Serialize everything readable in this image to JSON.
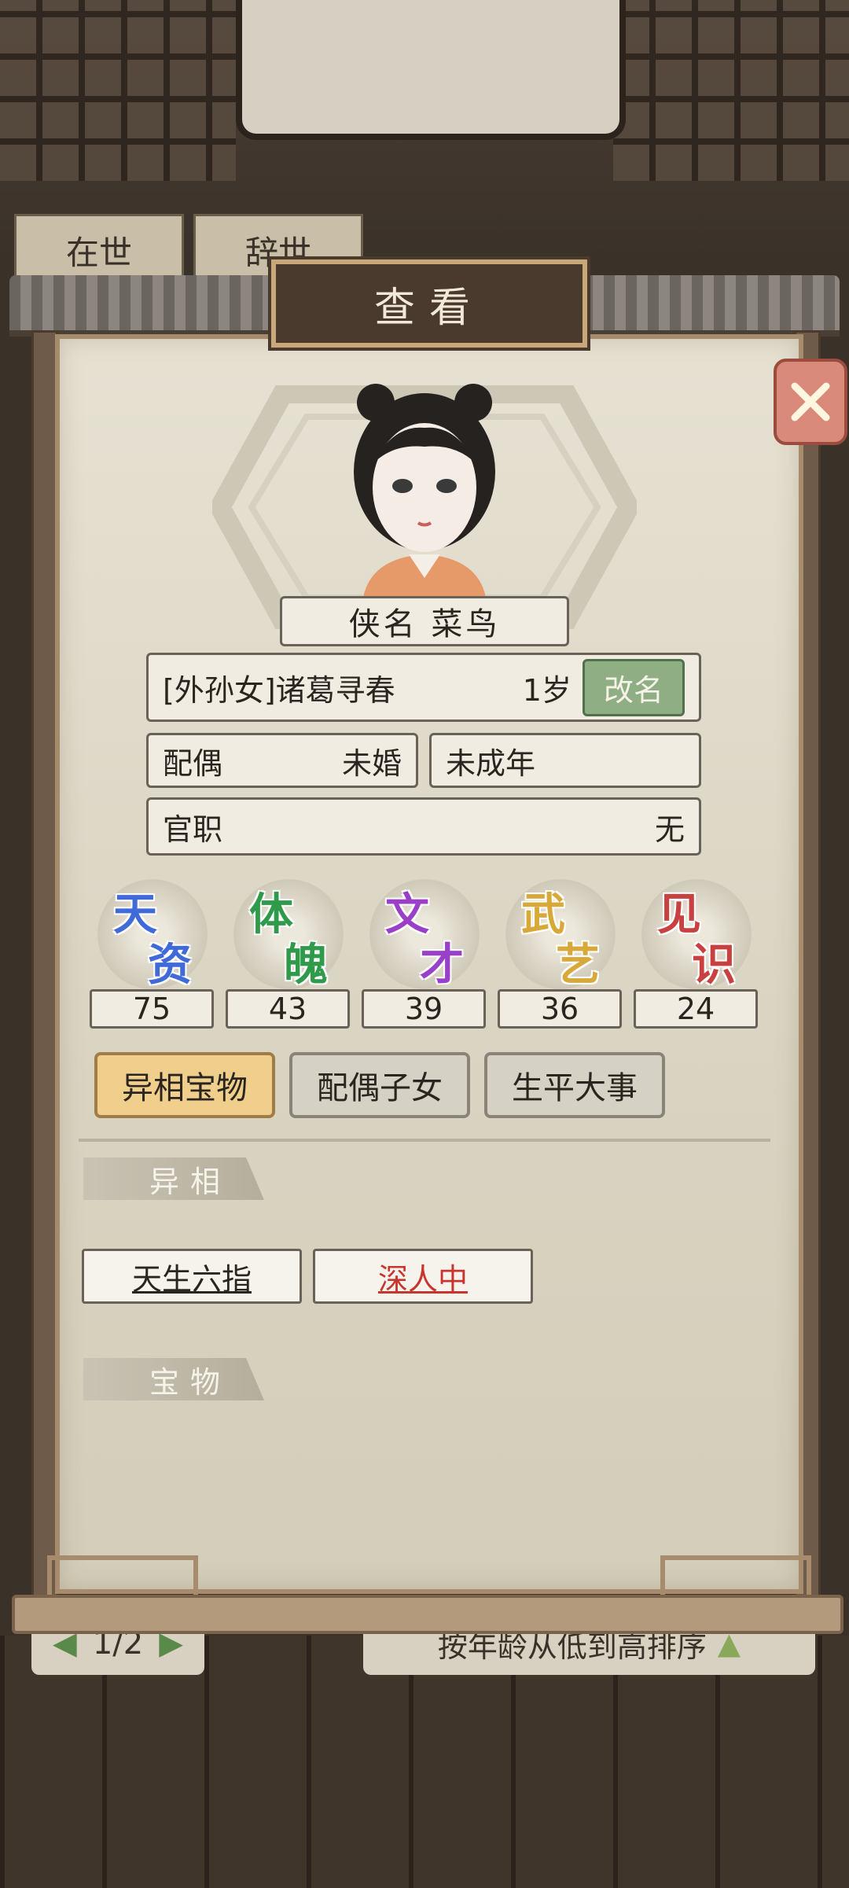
{
  "background": {
    "tabs": [
      "在世",
      "辞世"
    ],
    "pager": "1/2",
    "sort_label": "按年龄从低到高排序"
  },
  "panel": {
    "title": "查看",
    "alias": "侠名 菜鸟",
    "relation_name": "[外孙女]诸葛寻春",
    "age": "1岁",
    "rename_button": "改名",
    "spouse_label": "配偶",
    "spouse_value": "未婚",
    "maturity": "未成年",
    "office_label": "官职",
    "office_value": "无"
  },
  "stats": [
    {
      "label_1": "天",
      "label_2": "资",
      "value": "75",
      "color": "#3f6ad8"
    },
    {
      "label_1": "体",
      "label_2": "魄",
      "value": "43",
      "color": "#2f9a4a"
    },
    {
      "label_1": "文",
      "label_2": "才",
      "value": "39",
      "color": "#9a3fc8"
    },
    {
      "label_1": "武",
      "label_2": "艺",
      "value": "36",
      "color": "#d8a838"
    },
    {
      "label_1": "见",
      "label_2": "识",
      "value": "24",
      "color": "#c84040"
    }
  ],
  "tabs": [
    "异相宝物",
    "配偶子女",
    "生平大事"
  ],
  "sections": {
    "traits_title": "异相",
    "treasures_title": "宝物"
  },
  "traits": [
    {
      "label": "天生六指",
      "color": "#2b2520"
    },
    {
      "label": "深人中",
      "color": "#c8352e"
    }
  ]
}
